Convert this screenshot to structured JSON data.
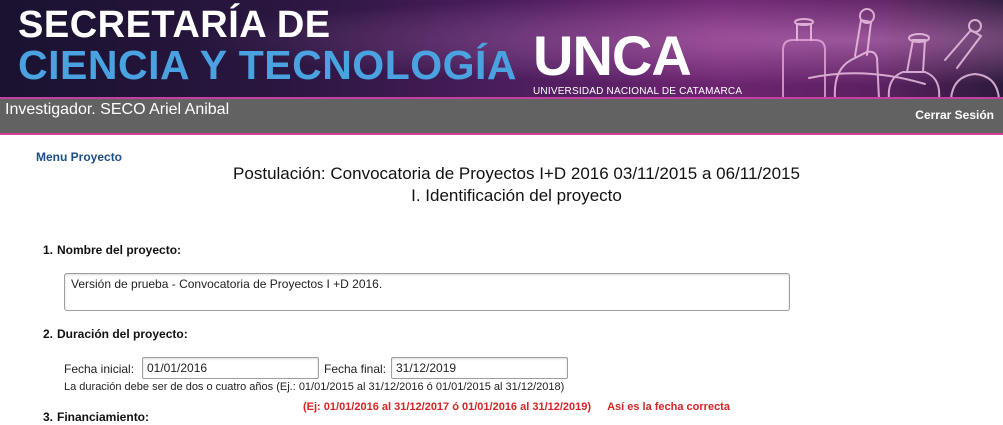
{
  "header": {
    "title_line1": "SECRETARÍA DE",
    "title_line2": "CIENCIA Y TECNOLOGÍA",
    "logo_un": "UN",
    "logo_ca": "CA",
    "logo_subtitle": "UNIVERSIDAD NACIONAL DE CATAMARCA",
    "lab_art_icon": "lab-glassware-icon"
  },
  "userbar": {
    "user": "Investigador. SECO Ariel Anibal",
    "logout": "Cerrar Sesión"
  },
  "menu": {
    "link": "Menu Proyecto"
  },
  "page": {
    "title": "Postulación: Convocatoria de Proyectos I+D 2016 03/11/2015 a 06/11/2015",
    "subtitle": "I. Identificación del proyecto"
  },
  "sections": {
    "s1": {
      "num": "1.",
      "label": "Nombre del proyecto:",
      "value": "Versión de prueba - Convocatoria de Proyectos I +D 2016."
    },
    "s2": {
      "num": "2.",
      "label": "Duración del proyecto:",
      "start_label": "Fecha inicial:",
      "start_value": "01/01/2016",
      "end_label": "Fecha final:",
      "end_value": "31/12/2019",
      "hint": "La duración debe ser de dos o cuatro años (Ej.: 01/01/2015 al 31/12/2016 ó 01/01/2015 al 31/12/2018)",
      "warning_example": "(Ej: 01/01/2016 al 31/12/2017 ó 01/01/2016 al 31/12/2019)",
      "warning_note": "Así es la fecha correcta"
    },
    "s3": {
      "num": "3.",
      "label": "Financiamiento:"
    }
  },
  "colors": {
    "title_blue": "#4aa3e0",
    "menu_link": "#1d4f86",
    "warning_red": "#d42525",
    "userbar_bg": "#626262",
    "accent_pink": "#d43f9a"
  }
}
